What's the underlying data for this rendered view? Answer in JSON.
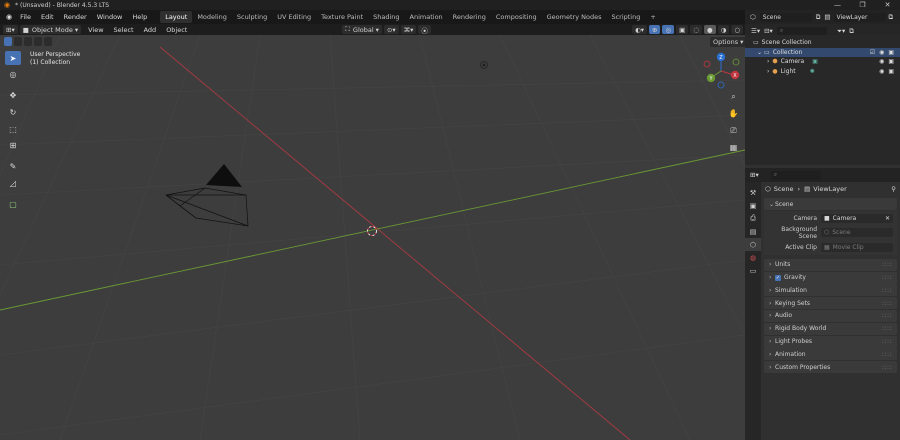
{
  "titlebar": {
    "title": "* (Unsaved) - Blender 4.5.3 LTS",
    "min": "—",
    "max": "❐",
    "close": "✕"
  },
  "menubar": {
    "menus": [
      "File",
      "Edit",
      "Render",
      "Window",
      "Help"
    ],
    "workspaces": [
      "Layout",
      "Modeling",
      "Sculpting",
      "UV Editing",
      "Texture Paint",
      "Shading",
      "Animation",
      "Rendering",
      "Compositing",
      "Geometry Nodes",
      "Scripting"
    ],
    "add_tab": "+",
    "scene": "Scene",
    "view_layer": "ViewLayer"
  },
  "viewport_header": {
    "mode": "Object Mode",
    "menus": [
      "View",
      "Select",
      "Add",
      "Object"
    ],
    "orientation": "Global",
    "options": "Options"
  },
  "viewport": {
    "perspective": "User Perspective",
    "collection": "(1) Collection"
  },
  "gizmo": {
    "x": "X",
    "y": "Y",
    "z": "Z"
  },
  "outliner": {
    "search_placeholder": "",
    "root": "Scene Collection",
    "collection": "Collection",
    "items": [
      "Camera",
      "Light"
    ]
  },
  "properties": {
    "search_placeholder": "",
    "breadcrumb_scene": "Scene",
    "breadcrumb_layer": "ViewLayer",
    "section": "Scene",
    "camera_label": "Camera",
    "camera_value": "Camera",
    "bg_label": "Background Scene",
    "bg_placeholder": "Scene",
    "clip_label": "Active Clip",
    "clip_placeholder": "Movie Clip",
    "panels": [
      "Units",
      "Gravity",
      "Simulation",
      "Keying Sets",
      "Audio",
      "Rigid Body World",
      "Light Probes",
      "Animation",
      "Custom Properties"
    ]
  },
  "colors": {
    "accent": "#4772b3",
    "x_axis": "#c0363f",
    "y_axis": "#6b9a34",
    "z_axis": "#2a6fd0"
  }
}
